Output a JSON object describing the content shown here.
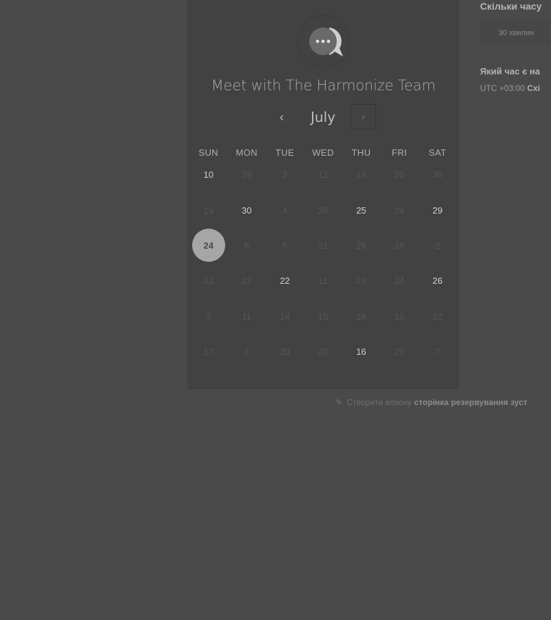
{
  "card": {
    "title": "Meet with The Harmonize Team",
    "logo_icon": "chat-bubble-logo-icon"
  },
  "calendar": {
    "month": "July",
    "prev_icon": "‹",
    "next_icon": "›",
    "weekdays": [
      "SUN",
      "MON",
      "TUE",
      "WED",
      "THU",
      "FRI",
      "SAT"
    ],
    "days": [
      {
        "label": "10",
        "state": "available"
      },
      {
        "label": "28",
        "state": "disabled"
      },
      {
        "label": "2",
        "state": "disabled"
      },
      {
        "label": "12",
        "state": "disabled"
      },
      {
        "label": "14",
        "state": "disabled"
      },
      {
        "label": "20",
        "state": "disabled"
      },
      {
        "label": "30",
        "state": "disabled"
      },
      {
        "label": "19",
        "state": "disabled"
      },
      {
        "label": "30",
        "state": "available"
      },
      {
        "label": "4",
        "state": "disabled"
      },
      {
        "label": "28",
        "state": "disabled"
      },
      {
        "label": "25",
        "state": "available"
      },
      {
        "label": "24",
        "state": "disabled"
      },
      {
        "label": "29",
        "state": "available"
      },
      {
        "label": "24",
        "state": "selected"
      },
      {
        "label": "6",
        "state": "disabled"
      },
      {
        "label": "8",
        "state": "disabled"
      },
      {
        "label": "21",
        "state": "disabled"
      },
      {
        "label": "28",
        "state": "disabled"
      },
      {
        "label": "19",
        "state": "disabled"
      },
      {
        "label": "2",
        "state": "disabled"
      },
      {
        "label": "22",
        "state": "disabled"
      },
      {
        "label": "22",
        "state": "disabled"
      },
      {
        "label": "22",
        "state": "available"
      },
      {
        "label": "11",
        "state": "disabled"
      },
      {
        "label": "23",
        "state": "disabled"
      },
      {
        "label": "24",
        "state": "disabled"
      },
      {
        "label": "26",
        "state": "available"
      },
      {
        "label": "3",
        "state": "disabled"
      },
      {
        "label": "11",
        "state": "disabled"
      },
      {
        "label": "14",
        "state": "disabled"
      },
      {
        "label": "15",
        "state": "disabled"
      },
      {
        "label": "18",
        "state": "disabled"
      },
      {
        "label": "10",
        "state": "disabled"
      },
      {
        "label": "22",
        "state": "disabled"
      },
      {
        "label": "17",
        "state": "disabled"
      },
      {
        "label": "2",
        "state": "disabled"
      },
      {
        "label": "29",
        "state": "disabled"
      },
      {
        "label": "20",
        "state": "disabled"
      },
      {
        "label": "16",
        "state": "available"
      },
      {
        "label": "29",
        "state": "disabled"
      },
      {
        "label": "7",
        "state": "disabled"
      }
    ]
  },
  "side": {
    "duration_question": "Скільки часу",
    "duration_option": "30 хвилин",
    "time_question": "Який час є на",
    "timezone_offset": "UTC +03:00",
    "timezone_name": "Схі"
  },
  "footer": {
    "pen_icon": "✎",
    "text": "Створити власну",
    "link": "сторінка резервування зуст"
  },
  "colors": {
    "background": "#4a4a4a",
    "card": "#424242",
    "selected": "#a6a6a6"
  }
}
